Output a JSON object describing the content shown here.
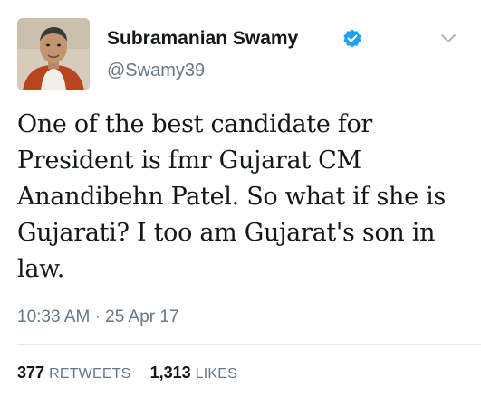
{
  "user": {
    "display_name": "Subramanian Swamy",
    "handle": "@Swamy39",
    "verified": true
  },
  "icons": {
    "verified": "verified-badge-icon",
    "menu": "chevron-down-icon"
  },
  "tweet": {
    "text": "One of the best candidate for\nPresident is fmr Gujarat CM\nAnandibehn Patel. So what if she is\nGujarati? I too am Gujarat's son in\nlaw.",
    "time": "10:33 AM",
    "separator": "·",
    "date": "25 Apr 17"
  },
  "stats": {
    "retweets_count": "377",
    "retweets_label": "RETWEETS",
    "likes_count": "1,313",
    "likes_label": "LIKES"
  },
  "colors": {
    "verified_blue": "#1da1f2",
    "secondary_text": "#657786",
    "primary_text": "#14171a",
    "divider": "#e1e8ed"
  }
}
